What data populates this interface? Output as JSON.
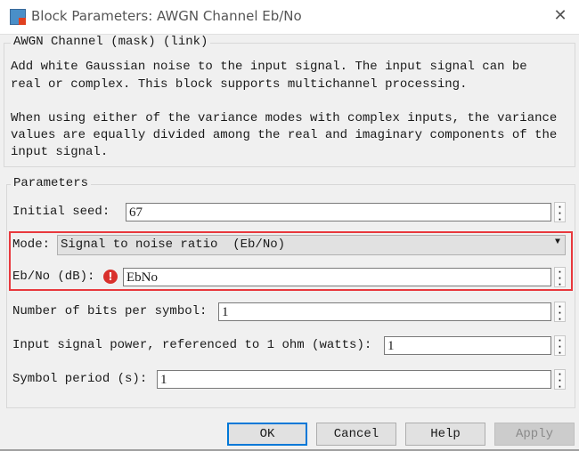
{
  "window": {
    "title": "Block Parameters: AWGN Channel Eb/No",
    "close_icon": "close-icon",
    "app_icon": "simulink-block-icon"
  },
  "description": {
    "legend": "AWGN Channel (mask) (link)",
    "lines": [
      "Add white Gaussian noise to the input signal. The input signal can be",
      "real or complex. This block supports multichannel processing.",
      "When using either of the variance modes with complex inputs, the variance",
      "values are equally divided among the real and imaginary components of the",
      "input signal."
    ]
  },
  "parameters": {
    "legend": "Parameters",
    "initial_seed": {
      "label": "Initial seed:",
      "value": "67"
    },
    "mode": {
      "label": "Mode:",
      "value": "Signal to noise ratio  (Eb/No)"
    },
    "ebno": {
      "label": "Eb/No (dB):",
      "value": "EbNo",
      "error_icon": "error-icon"
    },
    "bits_per_symbol": {
      "label": "Number of bits per symbol:",
      "value": "1"
    },
    "signal_power": {
      "label": "Input signal power, referenced to 1 ohm (watts):",
      "value": "1"
    },
    "symbol_period": {
      "label": "Symbol period (s):",
      "value": "1"
    },
    "highlight_color": "#e8383d"
  },
  "buttons": {
    "ok": "OK",
    "cancel": "Cancel",
    "help": "Help",
    "apply": "Apply"
  }
}
